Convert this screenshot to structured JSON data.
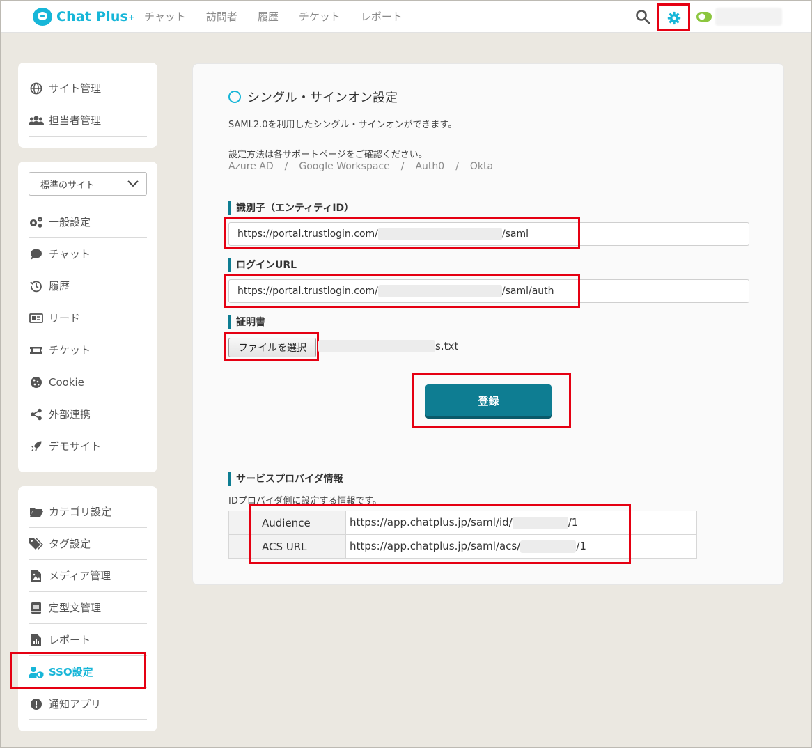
{
  "app": {
    "logo_text": "Chat Plus",
    "logo_plus": "+",
    "nav": [
      "チャット",
      "訪問者",
      "履歴",
      "チケット",
      "レポート"
    ]
  },
  "sidebar": {
    "panel1": [
      {
        "label": "サイト管理",
        "icon": "globe-icon"
      },
      {
        "label": "担当者管理",
        "icon": "users-icon"
      }
    ],
    "site_select": "標準のサイト",
    "panel2": [
      {
        "label": "一般設定",
        "icon": "gears-icon"
      },
      {
        "label": "チャット",
        "icon": "chat-bubble-icon"
      },
      {
        "label": "履歴",
        "icon": "history-icon"
      },
      {
        "label": "リード",
        "icon": "lead-card-icon"
      },
      {
        "label": "チケット",
        "icon": "ticket-icon"
      },
      {
        "label": "Cookie",
        "icon": "cookie-icon"
      },
      {
        "label": "外部連携",
        "icon": "share-icon"
      },
      {
        "label": "デモサイト",
        "icon": "rocket-icon"
      }
    ],
    "panel3": [
      {
        "label": "カテゴリ設定",
        "icon": "folder-icon"
      },
      {
        "label": "タグ設定",
        "icon": "tags-icon"
      },
      {
        "label": "メディア管理",
        "icon": "media-file-icon"
      },
      {
        "label": "定型文管理",
        "icon": "book-icon"
      },
      {
        "label": "レポート",
        "icon": "report-icon"
      },
      {
        "label": "SSO設定",
        "icon": "user-shield-icon"
      },
      {
        "label": "通知アプリ",
        "icon": "alert-icon"
      }
    ]
  },
  "main": {
    "title": "シングル・サインオン設定",
    "description": "SAML2.0を利用したシングル・サインオンができます。",
    "howto": "設定方法は各サポートページをご確認ください。",
    "links": [
      "Azure AD",
      "Google Workspace",
      "Auth0",
      "Okta"
    ],
    "link_sep": "/",
    "entity_id": {
      "label": "識別子（エンティティID）",
      "prefix": "https://portal.trustlogin.com/",
      "suffix": "/saml"
    },
    "login_url": {
      "label": "ログインURL",
      "prefix": "https://portal.trustlogin.com/",
      "suffix": "/saml/auth"
    },
    "certificate": {
      "label": "証明書",
      "button": "ファイルを選択",
      "file_suffix": "s.txt"
    },
    "submit": "登録",
    "sp_info": {
      "label": "サービスプロバイダ情報",
      "description": "IDプロバイダ側に設定する情報です。",
      "rows": [
        {
          "key": "Audience",
          "prefix": "https://app.chatplus.jp/saml/id/",
          "suffix": "/1"
        },
        {
          "key": "ACS URL",
          "prefix": "https://app.chatplus.jp/saml/acs/",
          "suffix": "/1"
        }
      ]
    }
  },
  "colors": {
    "accent": "#17b6d8",
    "primary_button": "#0e7d92",
    "highlight": "#e50012"
  }
}
